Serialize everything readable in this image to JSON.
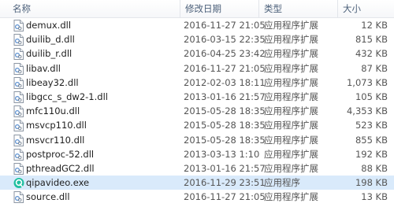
{
  "header": {
    "name": "名称",
    "date": "修改日期",
    "type": "类型",
    "size": "大小"
  },
  "files": [
    {
      "name": "demux.dll",
      "date": "2016-11-27 21:05",
      "type": "应用程序扩展",
      "size": "12 KB",
      "icon": "dll-file-icon"
    },
    {
      "name": "duilib_d.dll",
      "date": "2016-03-15 22:35",
      "type": "应用程序扩展",
      "size": "815 KB",
      "icon": "dll-file-icon"
    },
    {
      "name": "duilib_r.dll",
      "date": "2016-04-25 23:42",
      "type": "应用程序扩展",
      "size": "432 KB",
      "icon": "dll-file-icon"
    },
    {
      "name": "libav.dll",
      "date": "2016-11-27 21:05",
      "type": "应用程序扩展",
      "size": "87 KB",
      "icon": "dll-file-icon"
    },
    {
      "name": "libeay32.dll",
      "date": "2012-02-03 18:11",
      "type": "应用程序扩展",
      "size": "1,073 KB",
      "icon": "dll-file-icon"
    },
    {
      "name": "libgcc_s_dw2-1.dll",
      "date": "2013-01-16 21:57",
      "type": "应用程序扩展",
      "size": "105 KB",
      "icon": "dll-file-icon"
    },
    {
      "name": "mfc110u.dll",
      "date": "2015-05-28 18:35",
      "type": "应用程序扩展",
      "size": "4,353 KB",
      "icon": "dll-file-icon"
    },
    {
      "name": "msvcp110.dll",
      "date": "2015-05-28 18:35",
      "type": "应用程序扩展",
      "size": "523 KB",
      "icon": "dll-file-icon"
    },
    {
      "name": "msvcr110.dll",
      "date": "2015-05-28 18:35",
      "type": "应用程序扩展",
      "size": "855 KB",
      "icon": "dll-file-icon"
    },
    {
      "name": "postproc-52.dll",
      "date": "2013-03-13 1:10",
      "type": "应用程序扩展",
      "size": "192 KB",
      "icon": "dll-file-icon"
    },
    {
      "name": "pthreadGC2.dll",
      "date": "2013-01-16 21:57",
      "type": "应用程序扩展",
      "size": "88 KB",
      "icon": "dll-file-icon"
    },
    {
      "name": "qipavideo.exe",
      "date": "2016-11-29 23:51",
      "type": "应用程序",
      "size": "198 KB",
      "icon": "qipa-app-icon",
      "selected": true
    },
    {
      "name": "source.dll",
      "date": "2016-11-27 21:05",
      "type": "应用程序扩展",
      "size": "13 KB",
      "icon": "dll-file-icon"
    }
  ],
  "colors": {
    "header_text": "#4c607a",
    "selection": "#d9eafb",
    "app_icon": "#1fbfa0"
  }
}
